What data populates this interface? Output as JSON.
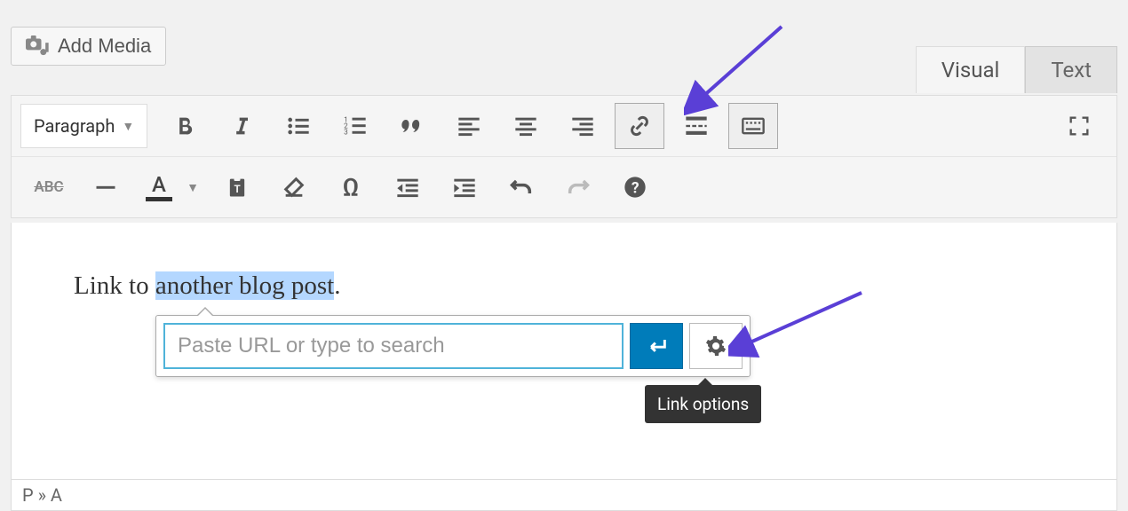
{
  "add_media_label": "Add Media",
  "tabs": {
    "visual": "Visual",
    "text": "Text"
  },
  "format_select": "Paragraph",
  "content": {
    "prefix": "Link to",
    "highlighted": "another blog post",
    "suffix": "."
  },
  "link_popup": {
    "placeholder": "Paste URL or type to search"
  },
  "tooltip": "Link options",
  "status_path": "P » A"
}
